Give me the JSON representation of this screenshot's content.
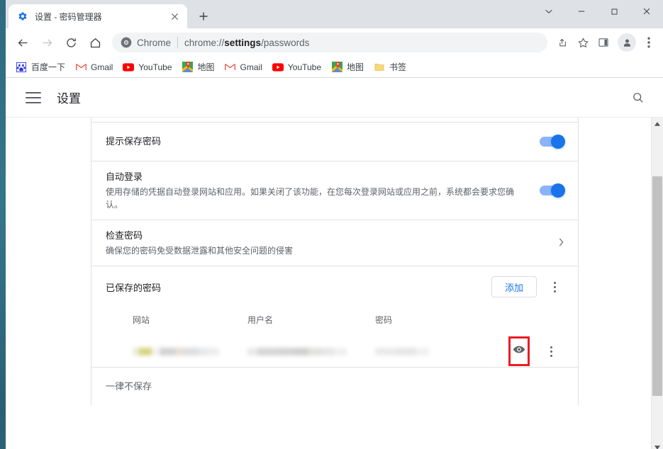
{
  "window": {
    "controls": {
      "collapse": "chevron-down",
      "minimize": "minimize",
      "maximize": "maximize",
      "close": "close"
    }
  },
  "tabstrip": {
    "tab": {
      "favicon": "gear-icon",
      "title": "设置 - 密码管理器",
      "close_label": "✕"
    },
    "new_tab_label": "+"
  },
  "toolbar": {
    "back_label": "←",
    "forward_label": "→",
    "reload_label": "⟳",
    "home_label": "⌂",
    "omnibox": {
      "scheme_label": "Chrome",
      "url_prefix": "chrome://",
      "url_bold": "settings",
      "url_suffix": "/passwords"
    },
    "share_icon": "share-icon",
    "bookmark_icon": "star-icon",
    "sidepanel_icon": "side-panel-icon",
    "profile_icon": "avatar-icon",
    "menu_icon": "three-dots-icon"
  },
  "bookmarks": [
    {
      "icon": "baidu-icon",
      "label": "百度一下"
    },
    {
      "icon": "gmail-icon",
      "label": "Gmail"
    },
    {
      "icon": "youtube-icon",
      "label": "YouTube"
    },
    {
      "icon": "maps-icon",
      "label": "地图"
    },
    {
      "icon": "gmail-icon",
      "label": "Gmail"
    },
    {
      "icon": "youtube-icon",
      "label": "YouTube"
    },
    {
      "icon": "maps-icon",
      "label": "地图"
    },
    {
      "icon": "folder-icon",
      "label": "书签"
    }
  ],
  "settings_header": {
    "menu_icon": "hamburger-icon",
    "title": "设置",
    "search_icon": "search-icon"
  },
  "settings": {
    "clipped_row_text": "",
    "offer_save": {
      "title": "提示保存密码"
    },
    "auto_signin": {
      "title": "自动登录",
      "subtitle": "使用存储的凭据自动登录网站和应用。如果关闭了该功能，在您每次登录网站或应用之前，系统都会要求您确认。"
    },
    "check_passwords": {
      "title": "检查密码",
      "subtitle": "确保您的密码免受数据泄露和其他安全问题的侵害",
      "chevron": "›"
    },
    "saved_passwords": {
      "label": "已保存的密码",
      "add_button": "添加",
      "more_menu": "three-dots-icon",
      "columns": [
        "网站",
        "用户名",
        "密码"
      ],
      "rows": [
        {
          "site": "",
          "username": "",
          "password": "",
          "show_icon": "eye-icon",
          "row_menu": "three-dots-icon",
          "highlighted": true
        }
      ]
    },
    "never_saved": {
      "label": "一律不保存"
    }
  },
  "scrollbar": {
    "up_arrow": "▲",
    "down_arrow": "▼"
  },
  "colors": {
    "accent_blue": "#1a73e8",
    "toggle_track": "#8ab4f8",
    "highlight_red": "#ec1c24",
    "desktop_teal": "#2e6a80"
  }
}
